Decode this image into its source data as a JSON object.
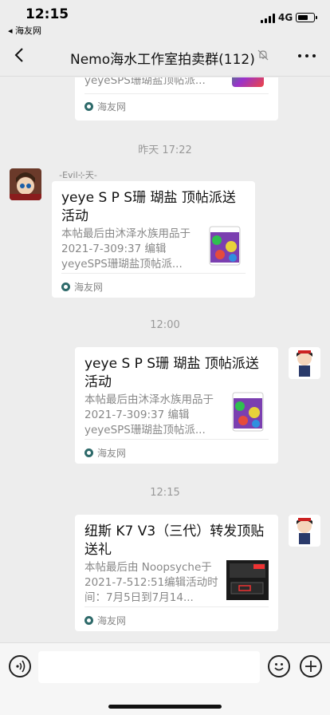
{
  "status": {
    "time": "12:15",
    "back_app": "◂ 海友网",
    "network": "4G",
    "battery_level": 0.7
  },
  "nav": {
    "title": "Nemo海水工作室拍卖群(112)"
  },
  "messages": [
    {
      "desc": "yeyeSPS珊瑚盐顶帖派...",
      "source": "海友网"
    },
    {
      "timestamp": "昨天 17:22",
      "nickname": "ﾠ-Evil⊹天-ﾠ",
      "title": "yeye S P S珊 瑚盐 顶帖派送活动",
      "desc": "本帖最后由沐泽水族用品于 2021-7-309:37 编辑 yeyeSPS珊瑚盐顶帖派...",
      "source": "海友网"
    },
    {
      "timestamp": "12:00",
      "title": "yeye S P S珊 瑚盐 顶帖派送活动",
      "desc": "本帖最后由沐泽水族用品于 2021-7-309:37 编辑 yeyeSPS珊瑚盐顶帖派...",
      "source": "海友网"
    },
    {
      "timestamp": "12:15",
      "title": "纽斯 K7 V3（三代）转发顶贴送礼",
      "desc": "本帖最后由 Noopsyche于 2021-7-512:51编辑活动时间：7月5日到7月14...",
      "source": "海友网"
    }
  ],
  "colors": {
    "background": "#ededed",
    "card": "#ffffff",
    "source_icon": "#2e6a6a"
  }
}
